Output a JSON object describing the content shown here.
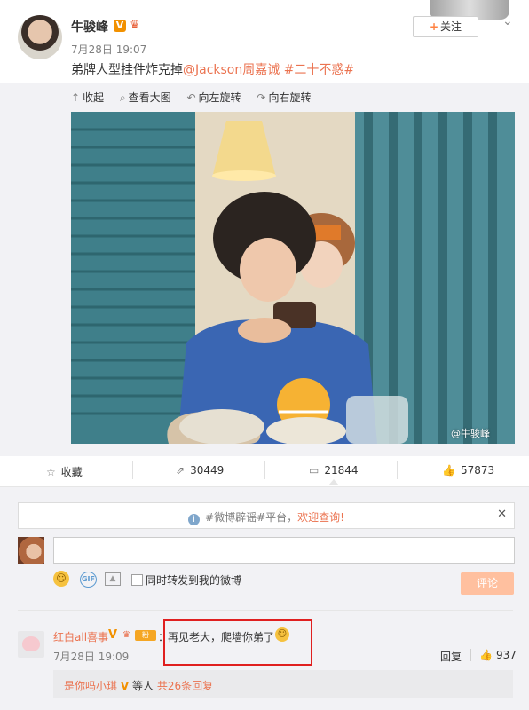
{
  "header": {
    "author": "牛骏峰",
    "verified_badge": "V",
    "time": "7月28日 19:07",
    "follow_label": "关注",
    "text_plain": "弟牌人型挂件炸克掉",
    "mention": "@Jackson周嘉诚",
    "hashtag": "#二十不惑#"
  },
  "image_toolbar": {
    "collapse": "收起",
    "view_large": "查看大图",
    "rotate_left": "向左旋转",
    "rotate_right": "向右旋转"
  },
  "image": {
    "watermark": "@牛骏峰"
  },
  "actions": {
    "favorite": "收藏",
    "forward_count": "30449",
    "comment_count": "21844",
    "like_count": "57873"
  },
  "notice": {
    "prefix": "#微博辟谣#平台，",
    "link": "欢迎查询!"
  },
  "composer": {
    "input_value": "",
    "sync_label": "同时转发到我的微博",
    "submit_label": "评论"
  },
  "comment": {
    "name": "红白all喜事",
    "colon": "：",
    "text": "再见老大，爬墙你弟了",
    "time": "7月28日 19:09",
    "reply_label": "回复",
    "like_count": "937",
    "sub_name": "是你吗小琪",
    "sub_middle": "等人",
    "sub_link": "共26条回复"
  },
  "colors": {
    "accent": "#eb7350",
    "panel": "#f2f2f5",
    "highlight_box": "#e02020"
  }
}
